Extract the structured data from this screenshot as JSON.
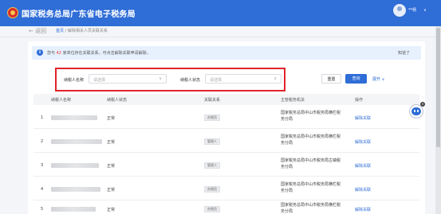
{
  "header": {
    "title": "国家税务总局广东省电子税务局",
    "user_name": "**杨",
    "caret": "∨"
  },
  "breadcrumb": {
    "back_label": "← 返回",
    "home": "首页",
    "sep": " / ",
    "current": "解除相关人员关联关系"
  },
  "notice": {
    "icon": "i",
    "prefix": "您与",
    "count": "42",
    "suffix": "家单位存在关联关系，可点击解除关联申请解除。",
    "dismiss": "知道了"
  },
  "filters": {
    "taxpayer_name_label": "纳税人名称",
    "taxpayer_name_placeholder": "请选择",
    "taxpayer_status_label": "纳税人状态",
    "taxpayer_status_placeholder": "请选择",
    "arrow": "∨"
  },
  "actions": {
    "reset": "重置",
    "query": "查询",
    "expand": "展开 ∨"
  },
  "table": {
    "columns": [
      "纳税人名称",
      "纳税人状态",
      "关联关系",
      "主管税务机关",
      "操作"
    ],
    "rows": [
      {
        "index": "1",
        "status": "正常",
        "relation": "办税员",
        "authority_line1": "国家税务总局中山市税务局横栏税",
        "authority_line2": "务分局",
        "action": "解除关联"
      },
      {
        "index": "2",
        "status": "正常",
        "relation": "管理人",
        "authority_line1": "国家税务总局中山市税务局横栏税",
        "authority_line2": "务分局",
        "action": "解除关联"
      },
      {
        "index": "3",
        "status": "正常",
        "relation": "管理人",
        "authority_line1": "国家税务总局中山市税务局古镇税",
        "authority_line2": "务分局",
        "action": "解除关联"
      },
      {
        "index": "4",
        "status": "正常",
        "relation": "办税员",
        "authority_line1": "国家税务总局中山市税务局横栏税",
        "authority_line2": "务分局",
        "action": "解除关联"
      },
      {
        "index": "5",
        "status": "正常",
        "relation": "办税员",
        "authority_line1": "国家税务总局中山市税务局横栏税",
        "authority_line2": "务分局",
        "action": "解除关联"
      }
    ]
  },
  "assistant": {
    "close": "×"
  },
  "colors": {
    "brand": "#2f6dd7",
    "highlight_border": "#e0232a",
    "notice_bg": "#e7f0fd"
  },
  "icons": [
    "tax-emblem-icon",
    "user-avatar-icon",
    "info-icon",
    "chevron-down-icon",
    "robot-assistant-icon",
    "close-icon"
  ]
}
